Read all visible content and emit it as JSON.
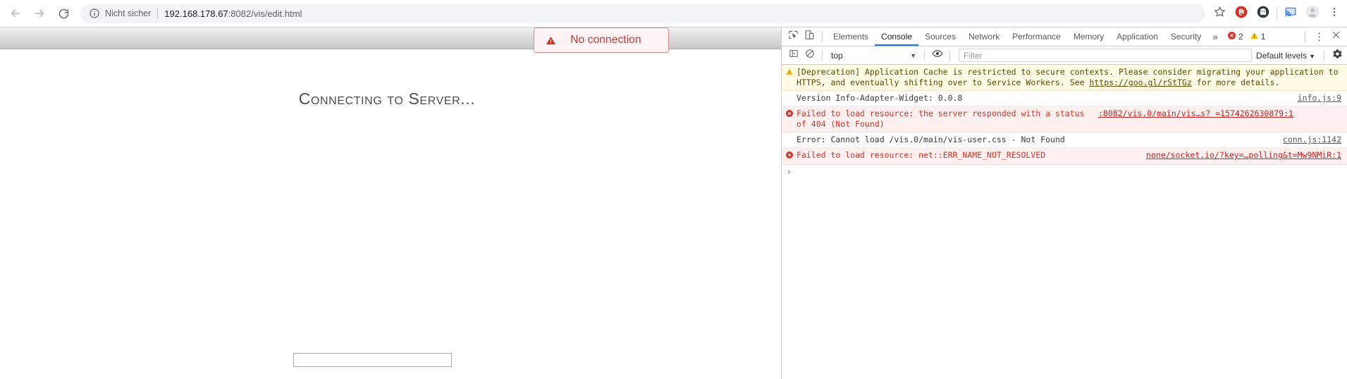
{
  "browser": {
    "nav": {
      "back_icon": "arrow-left-icon",
      "forward_icon": "arrow-right-icon",
      "reload_icon": "reload-icon"
    },
    "omnibox": {
      "info_icon": "info-circle-icon",
      "security_text": "Nicht sicher",
      "url_host": "192.168.178.67",
      "url_rest": ":8082/vis/edit.html",
      "full_url": "192.168.178.67:8082/vis/edit.html"
    },
    "actions": [
      {
        "name": "bookmark-star-icon",
        "label": "Bookmark"
      },
      {
        "name": "adblock-extension-icon",
        "label": "AdBlock"
      },
      {
        "name": "ghostery-extension-icon",
        "label": "Extension"
      },
      {
        "name": "cast-icon",
        "label": "Cast"
      },
      {
        "name": "profile-avatar-icon",
        "label": "Profile"
      },
      {
        "name": "chrome-menu-icon",
        "label": "Customize and control Google Chrome"
      }
    ]
  },
  "page": {
    "dialog": {
      "icon": "warning-triangle-icon",
      "title": "No connection",
      "border_color": "#d98a8f",
      "background_color": "#fdf3f4",
      "text_color": "#c23b3b"
    },
    "status_text": "Connecting to Server...",
    "input_value": "",
    "input_placeholder": ""
  },
  "devtools": {
    "inspect_icon": "inspect-element-icon",
    "device_icon": "device-toolbar-icon",
    "tabs": [
      {
        "label": "Elements",
        "active": false
      },
      {
        "label": "Console",
        "active": true
      },
      {
        "label": "Sources",
        "active": false
      },
      {
        "label": "Network",
        "active": false
      },
      {
        "label": "Performance",
        "active": false
      },
      {
        "label": "Memory",
        "active": false
      },
      {
        "label": "Application",
        "active": false
      },
      {
        "label": "Security",
        "active": false
      }
    ],
    "overflow_label": "»",
    "error_count": "2",
    "warning_count": "1",
    "more_label": "⋮",
    "close_label": "×",
    "active_tab_color": "#1a73e8",
    "toolbar": {
      "sidebar_icon": "console-sidebar-icon",
      "clear_icon": "clear-console-icon",
      "context_value": "top",
      "eye_icon": "live-expression-icon",
      "filter_placeholder": "Filter",
      "filter_value": "",
      "levels_value": "Default levels",
      "settings_icon": "gear-icon"
    },
    "messages": [
      {
        "type": "warning",
        "icon": "warning-triangle-icon",
        "text_before": "[Deprecation] Application Cache is restricted to secure contexts. Please consider migrating your application to HTTPS, and eventually shifting over to Service Workers. See ",
        "link": "https://goo.gl/rStTGz",
        "text_after": " for more details.",
        "source": ""
      },
      {
        "type": "log",
        "icon": "",
        "text_before": "Version Info-Adapter-Widget: 0.0.8",
        "link": "",
        "text_after": "",
        "source": "info.js:9"
      },
      {
        "type": "error",
        "icon": "error-circle-icon",
        "text_before": "Failed to load resource: the server responded with a status of 404 (Not Found)",
        "link": "",
        "text_after": "",
        "source": ":8082/vis.0/main/vis…s? =1574262630879:1"
      },
      {
        "type": "log",
        "icon": "",
        "text_before": "Error: Cannot load /vis.0/main/vis-user.css - Not Found",
        "link": "",
        "text_after": "",
        "source": "conn.js:1142"
      },
      {
        "type": "error",
        "icon": "error-circle-icon",
        "text_before": "Failed to load resource: net::ERR_NAME_NOT_RESOLVED",
        "link": "",
        "text_after": "",
        "source": "none/socket.io/?key=…polling&t=Mw9NMiR:1"
      }
    ],
    "prompt_caret": "›"
  }
}
